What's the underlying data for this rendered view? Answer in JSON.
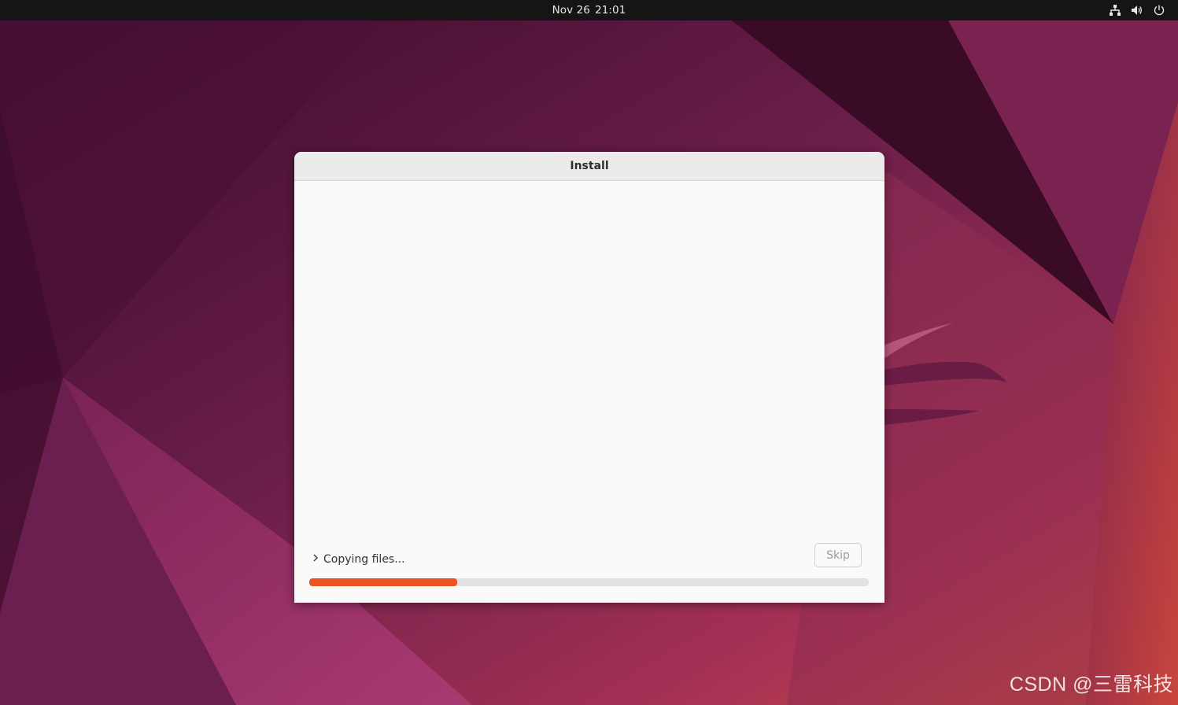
{
  "topbar": {
    "date": "Nov 26",
    "time": "21:01",
    "tray_icons": [
      "network-icon",
      "volume-icon",
      "power-icon"
    ]
  },
  "window": {
    "title": "Install",
    "status_text": "Copying files...",
    "skip_label": "Skip",
    "progress_percent": 26.5
  },
  "watermark": "CSDN @三雷科技",
  "colors": {
    "accent": "#e95420",
    "topbar": "#151515"
  }
}
